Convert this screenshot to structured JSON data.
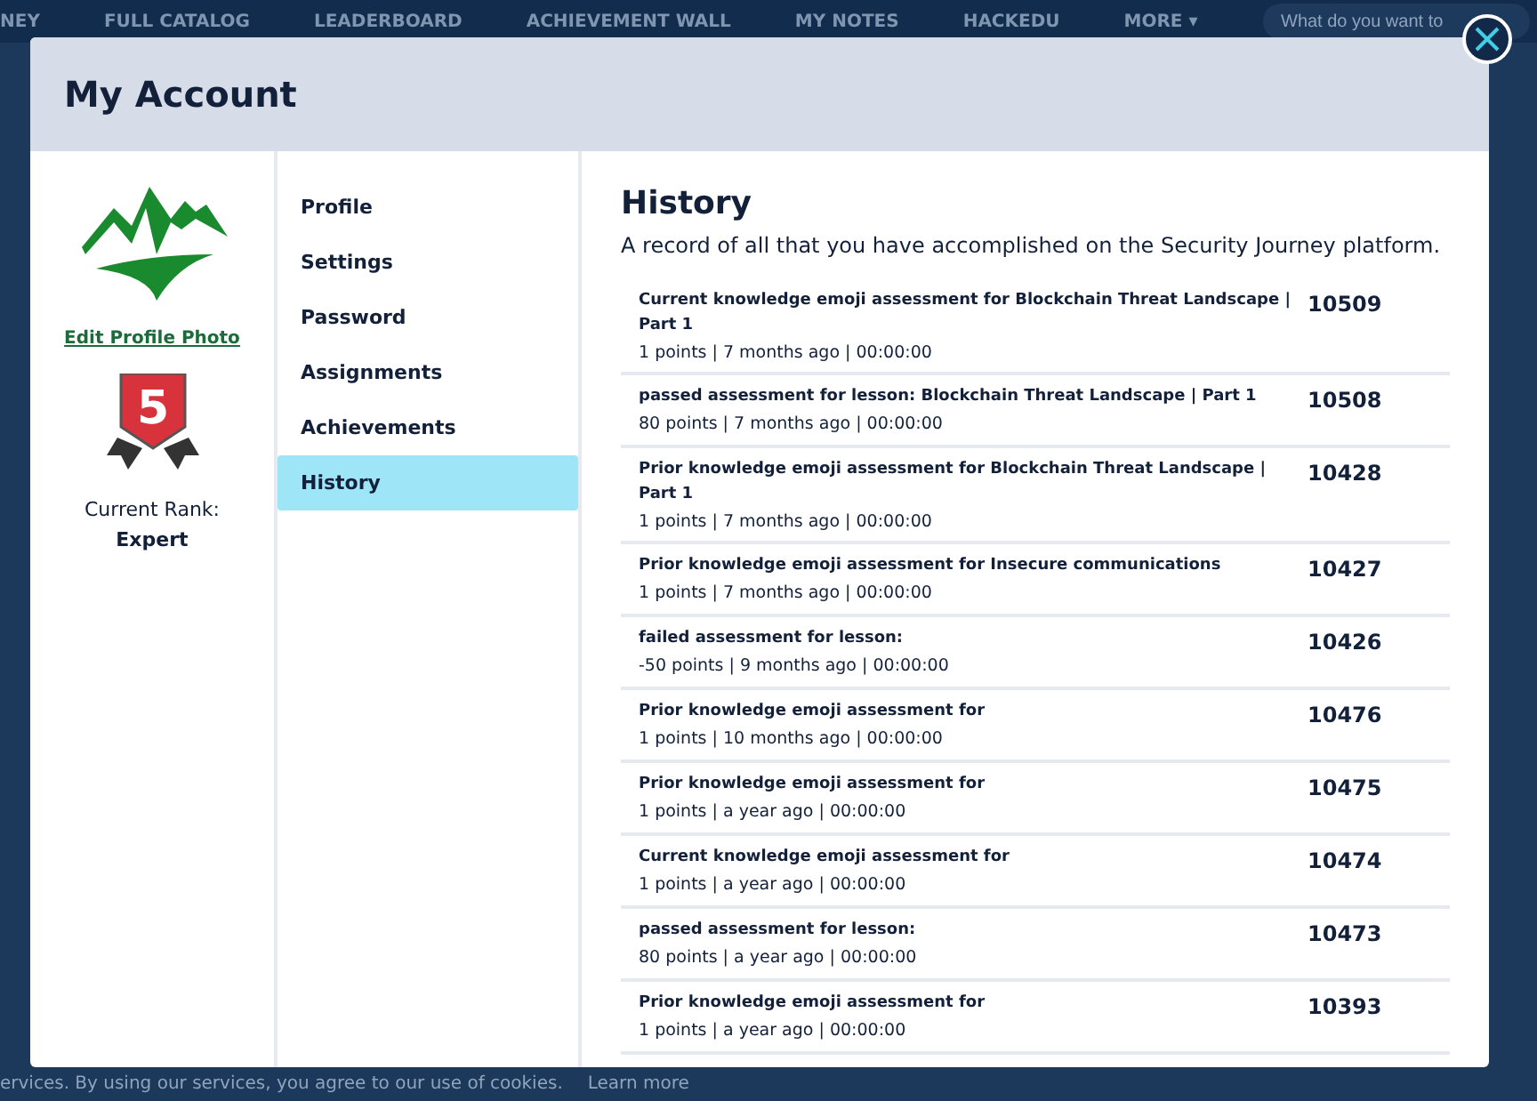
{
  "background_nav": {
    "items": [
      "NEY",
      "FULL CATALOG",
      "LEADERBOARD",
      "ACHIEVEMENT WALL",
      "MY NOTES",
      "HACKEDU",
      "MORE ▾"
    ],
    "search": {
      "placeholder": "What do you want to"
    }
  },
  "modal": {
    "title": "My Account",
    "profile": {
      "edit_photo_link": "Edit Profile Photo",
      "rank_badge": "5",
      "rank_label": "Current Rank:",
      "rank": "Expert"
    },
    "menu": [
      {
        "label": "Profile",
        "selected": false
      },
      {
        "label": "Settings",
        "selected": false
      },
      {
        "label": "Password",
        "selected": false
      },
      {
        "label": "Assignments",
        "selected": false
      },
      {
        "label": "Achievements",
        "selected": false
      },
      {
        "label": "History",
        "selected": true
      }
    ],
    "history": {
      "title": "History",
      "description": "A record of all that you have accomplished on the Security Journey platform.",
      "entries": [
        {
          "title": "Current knowledge emoji assessment for Blockchain Threat Landscape | Part 1",
          "meta": "1 points | 7 months ago | 00:00:00",
          "id": "10509"
        },
        {
          "title": "passed assessment for lesson: Blockchain Threat Landscape | Part 1",
          "meta": "80 points | 7 months ago | 00:00:00",
          "id": "10508"
        },
        {
          "title": "Prior knowledge emoji assessment for Blockchain Threat Landscape | Part 1",
          "meta": "1 points | 7 months ago | 00:00:00",
          "id": "10428"
        },
        {
          "title": "Prior knowledge emoji assessment for Insecure communications",
          "meta": "1 points | 7 months ago | 00:00:00",
          "id": "10427"
        },
        {
          "title": "failed assessment for lesson:",
          "meta": "-50 points | 9 months ago | 00:00:00",
          "id": "10426"
        },
        {
          "title": "Prior knowledge emoji assessment for",
          "meta": "1 points | 10 months ago | 00:00:00",
          "id": "10476"
        },
        {
          "title": "Prior knowledge emoji assessment for",
          "meta": "1 points | a year ago | 00:00:00",
          "id": "10475"
        },
        {
          "title": "Current knowledge emoji assessment for",
          "meta": "1 points | a year ago | 00:00:00",
          "id": "10474"
        },
        {
          "title": "passed assessment for lesson:",
          "meta": "80 points | a year ago | 00:00:00",
          "id": "10473"
        },
        {
          "title": "Prior knowledge emoji assessment for",
          "meta": "1 points | a year ago | 00:00:00",
          "id": "10393"
        }
      ]
    }
  },
  "cookie_bar": {
    "text": "ervices. By using our services, you agree to our use of cookies.",
    "link": "Learn more"
  }
}
